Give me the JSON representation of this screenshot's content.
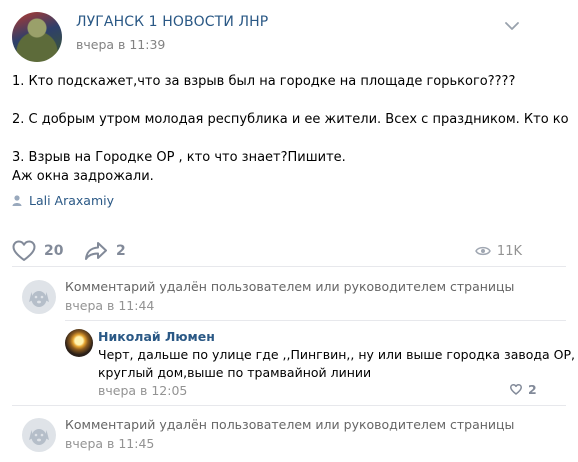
{
  "post": {
    "group_name": "ЛУГАНСК 1 НОВОСТИ ЛНР",
    "time": "вчера в 11:39",
    "lines": [
      "1. Кто подскажет,что за взрыв был на городке на площаде горького????",
      "",
      "2. С добрым утром молодая республика и ее жители. Всех с праздником. Кто ко",
      "",
      "3. Взрыв на Городке ОР , кто что знает?Пишите.",
      "Аж окна задрожали."
    ],
    "signer": "Lali Araxamiy",
    "likes": "20",
    "shares": "2",
    "views": "11K"
  },
  "comments": [
    {
      "text": "Комментарий удалён пользователем или руководителем страницы",
      "time": "вчера в 11:44"
    },
    {
      "author": "Николай Люмен",
      "line1": "Черт, дальше по улице где ,,Пингвин,, ну или выше городка завода ОР,",
      "line2": "круглый дом,выше по трамвайной линии",
      "time": "вчера в 12:05",
      "likes": "2"
    },
    {
      "text": "Комментарий удалён пользователем или руководителем страницы",
      "time": "вчера в 11:45"
    }
  ],
  "icons": {
    "like": "heart-icon",
    "share": "share-arrow-icon",
    "views": "eye-icon",
    "signer": "user-icon",
    "menu": "chevron-down-icon",
    "deleted_avatar": "dog-placeholder-icon"
  },
  "colors": {
    "link": "#2a5885",
    "muted": "#828282",
    "icon": "#828a99"
  }
}
